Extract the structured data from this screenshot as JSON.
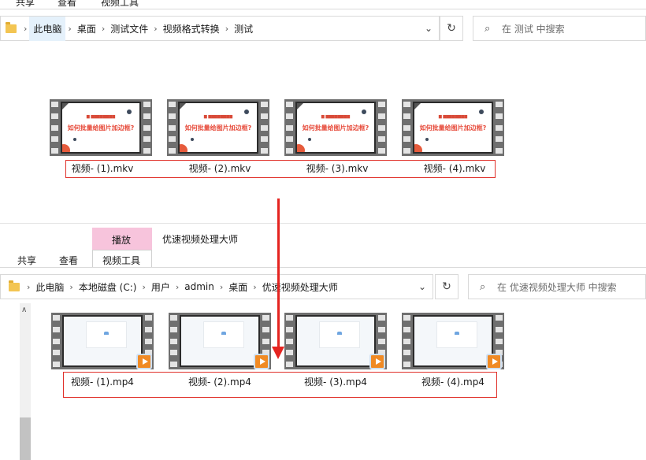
{
  "top_window": {
    "ribbon_tabs": [
      "共享",
      "查看",
      "视频工具"
    ],
    "breadcrumb": [
      "此电脑",
      "桌面",
      "测试文件",
      "视频格式转换",
      "测试"
    ],
    "search_placeholder": "在 测试 中搜索",
    "files": [
      "视频- (1).mkv",
      "视频- (2).mkv",
      "视频- (3).mkv",
      "视频- (4).mkv"
    ],
    "thumb_title": "如何批量给图片加边框?"
  },
  "bottom_window": {
    "context_tab": "播放",
    "window_title": "优速视频处理大师",
    "ribbon_tabs": [
      "共享",
      "查看",
      "视频工具"
    ],
    "breadcrumb": [
      "此电脑",
      "本地磁盘 (C:)",
      "用户",
      "admin",
      "桌面",
      "优速视频处理大师"
    ],
    "search_placeholder": "在 优速视频处理大师 中搜索",
    "files": [
      "视频- (1).mp4",
      "视频- (2).mp4",
      "视频- (3).mp4",
      "视频- (4).mp4"
    ]
  },
  "colors": {
    "highlight_box": "#e0302a",
    "arrow": "#e52420",
    "context_tab": "#f7c4dc",
    "play_badge": "#f08a24"
  },
  "icons": {
    "folder": "folder-icon",
    "refresh": "refresh-icon",
    "search": "search-icon",
    "play": "play-icon"
  }
}
